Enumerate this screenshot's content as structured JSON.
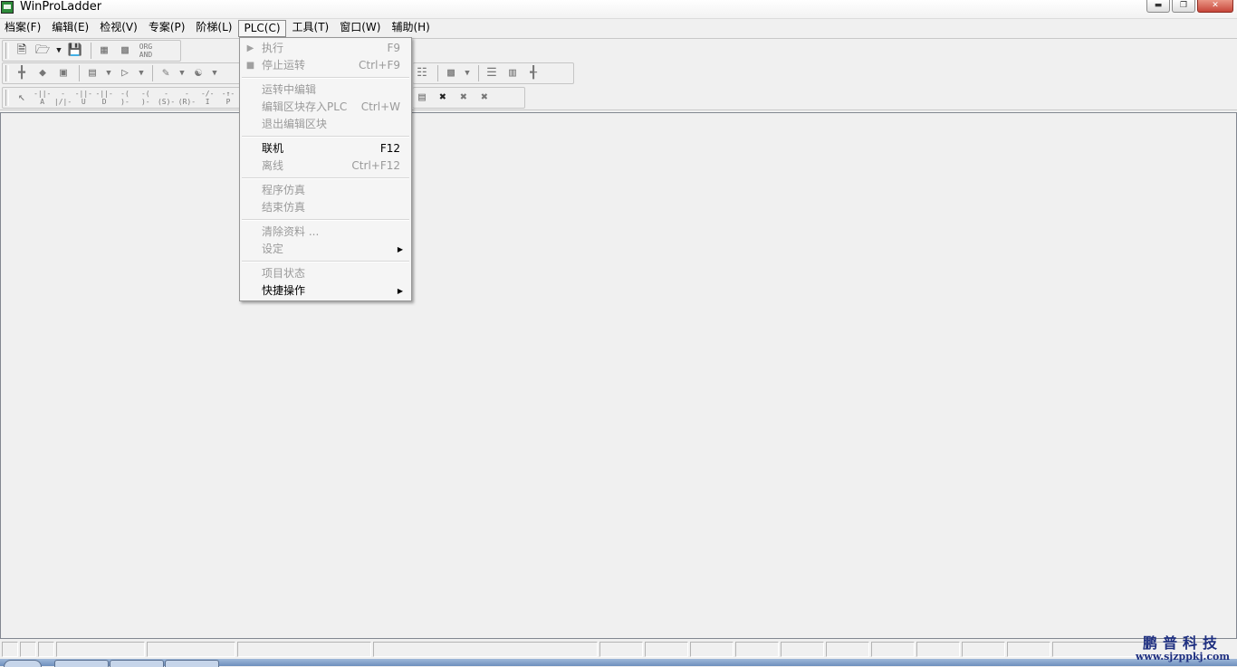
{
  "window": {
    "title": "WinProLadder"
  },
  "menubar": [
    "档案(F)",
    "编辑(E)",
    "检视(V)",
    "专案(P)",
    "阶梯(L)",
    "PLC(C)",
    "工具(T)",
    "窗口(W)",
    "辅助(H)"
  ],
  "toolbar1": {
    "org_and_line1": "ORG",
    "org_and_line2": "AND"
  },
  "toolbar3": {
    "contact_letters": [
      "A",
      "B",
      "U",
      "D",
      "O",
      "Q",
      "E",
      "R",
      "I",
      "P"
    ]
  },
  "plc_menu": {
    "run": {
      "label": "执行",
      "shortcut": "F9"
    },
    "stop": {
      "label": "停止运转",
      "shortcut": "Ctrl+F9"
    },
    "edit_in_run": {
      "label": "运转中编辑"
    },
    "save_block": {
      "label": "编辑区块存入PLC",
      "shortcut": "Ctrl+W"
    },
    "exit_edit": {
      "label": "退出编辑区块"
    },
    "online": {
      "label": "联机",
      "shortcut": "F12"
    },
    "offline": {
      "label": "离线",
      "shortcut": "Ctrl+F12"
    },
    "simulate": {
      "label": "程序仿真"
    },
    "end_simulate": {
      "label": "结束仿真"
    },
    "clear_data": {
      "label": "清除资料 ..."
    },
    "settings": {
      "label": "设定"
    },
    "project_status": {
      "label": "项目状态"
    },
    "quick_ops": {
      "label": "快捷操作"
    }
  },
  "watermark": {
    "name": "鹏普科技",
    "url": "www.sjzppkj.com"
  }
}
